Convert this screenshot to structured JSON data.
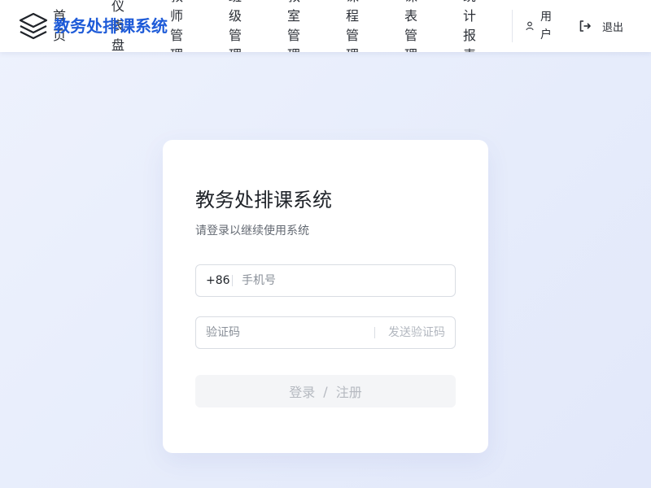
{
  "header": {
    "brand": "教务处排课系统",
    "nav": [
      "首页",
      "仪表盘",
      "教师管理",
      "班级管理",
      "教室管理",
      "课程管理",
      "课表管理",
      "统计报表"
    ],
    "user_label": "用户",
    "logout_label": "退出",
    "accent_color": "#1e5bd8"
  },
  "login": {
    "title": "教务处排课系统",
    "subtitle": "请登录以继续使用系统",
    "phone_prefix": "+86",
    "phone_placeholder": "手机号",
    "code_placeholder": "验证码",
    "send_code_label": "发送验证码",
    "login_label": "登录",
    "separator": "/",
    "register_label": "注册"
  },
  "icons": {
    "logo": "layers-icon",
    "user": "user-icon",
    "logout": "logout-icon"
  }
}
